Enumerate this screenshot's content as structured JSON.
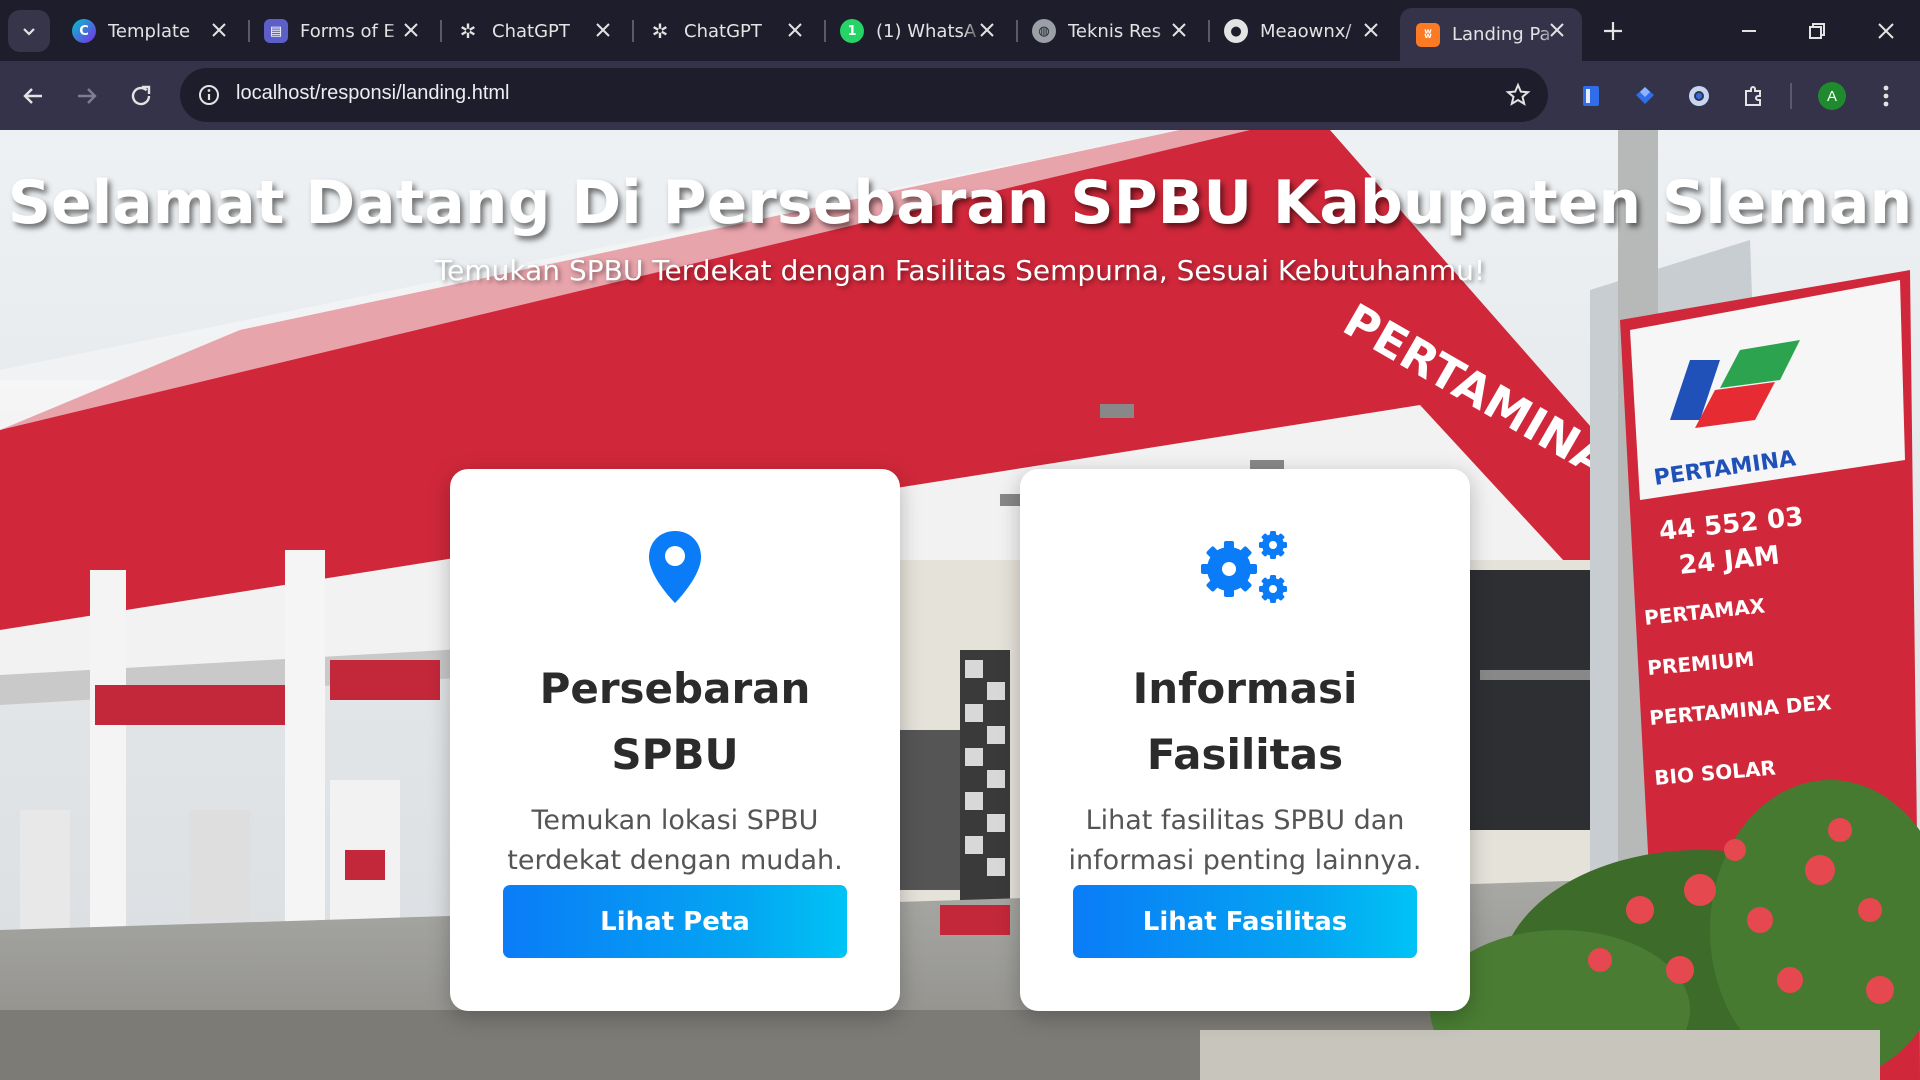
{
  "browser": {
    "tabs": [
      {
        "title": "Template",
        "icon": "canva-icon",
        "color": "#7d2ae8",
        "active": false
      },
      {
        "title": "Forms of E",
        "icon": "forms-icon",
        "color": "#5b5fc7",
        "active": false
      },
      {
        "title": "ChatGPT",
        "icon": "chatgpt-icon",
        "color": "#e3e3e3",
        "active": false
      },
      {
        "title": "ChatGPT",
        "icon": "chatgpt-icon",
        "color": "#e3e3e3",
        "active": false
      },
      {
        "title": "(1) WhatsA",
        "icon": "whatsapp-icon",
        "color": "#25d366",
        "active": false
      },
      {
        "title": "Teknis Res",
        "icon": "globe-icon",
        "color": "#9aa0a6",
        "active": false
      },
      {
        "title": "Meaownx/",
        "icon": "github-icon",
        "color": "#e3e3e3",
        "active": false
      },
      {
        "title": "Landing Pa",
        "icon": "xampp-icon",
        "color": "#fb7a24",
        "active": true
      }
    ],
    "url": "localhost/responsi/landing.html",
    "profile_initial": "A"
  },
  "hero": {
    "title": "Selamat Datang Di Persebaran SPBU Kabupaten Sleman",
    "subtitle": "Temukan SPBU Terdekat dengan Fasilitas Sempurna, Sesuai Kebutuhanmu!"
  },
  "background_sign": {
    "brand": "PERTAMINA",
    "phone": "44 552 03",
    "hours": "24 JAM",
    "products": [
      "PERTAMAX",
      "PREMIUM",
      "PERTAMINA DEX",
      "BIO SOLAR"
    ]
  },
  "cards": [
    {
      "icon": "map-pin-icon",
      "title": "Persebaran SPBU",
      "description": "Temukan lokasi SPBU terdekat dengan mudah.",
      "button": "Lihat Peta"
    },
    {
      "icon": "gears-icon",
      "title": "Informasi Fasilitas",
      "description": "Lihat fasilitas SPBU dan informasi penting lainnya.",
      "button": "Lihat Fasilitas"
    }
  ],
  "colors": {
    "accent_blue": "#0a7cf7",
    "accent_cyan": "#00c3f5",
    "canopy_red": "#d0283a",
    "chrome_dark": "#1e1d2b",
    "chrome_toolbar": "#35334a"
  }
}
